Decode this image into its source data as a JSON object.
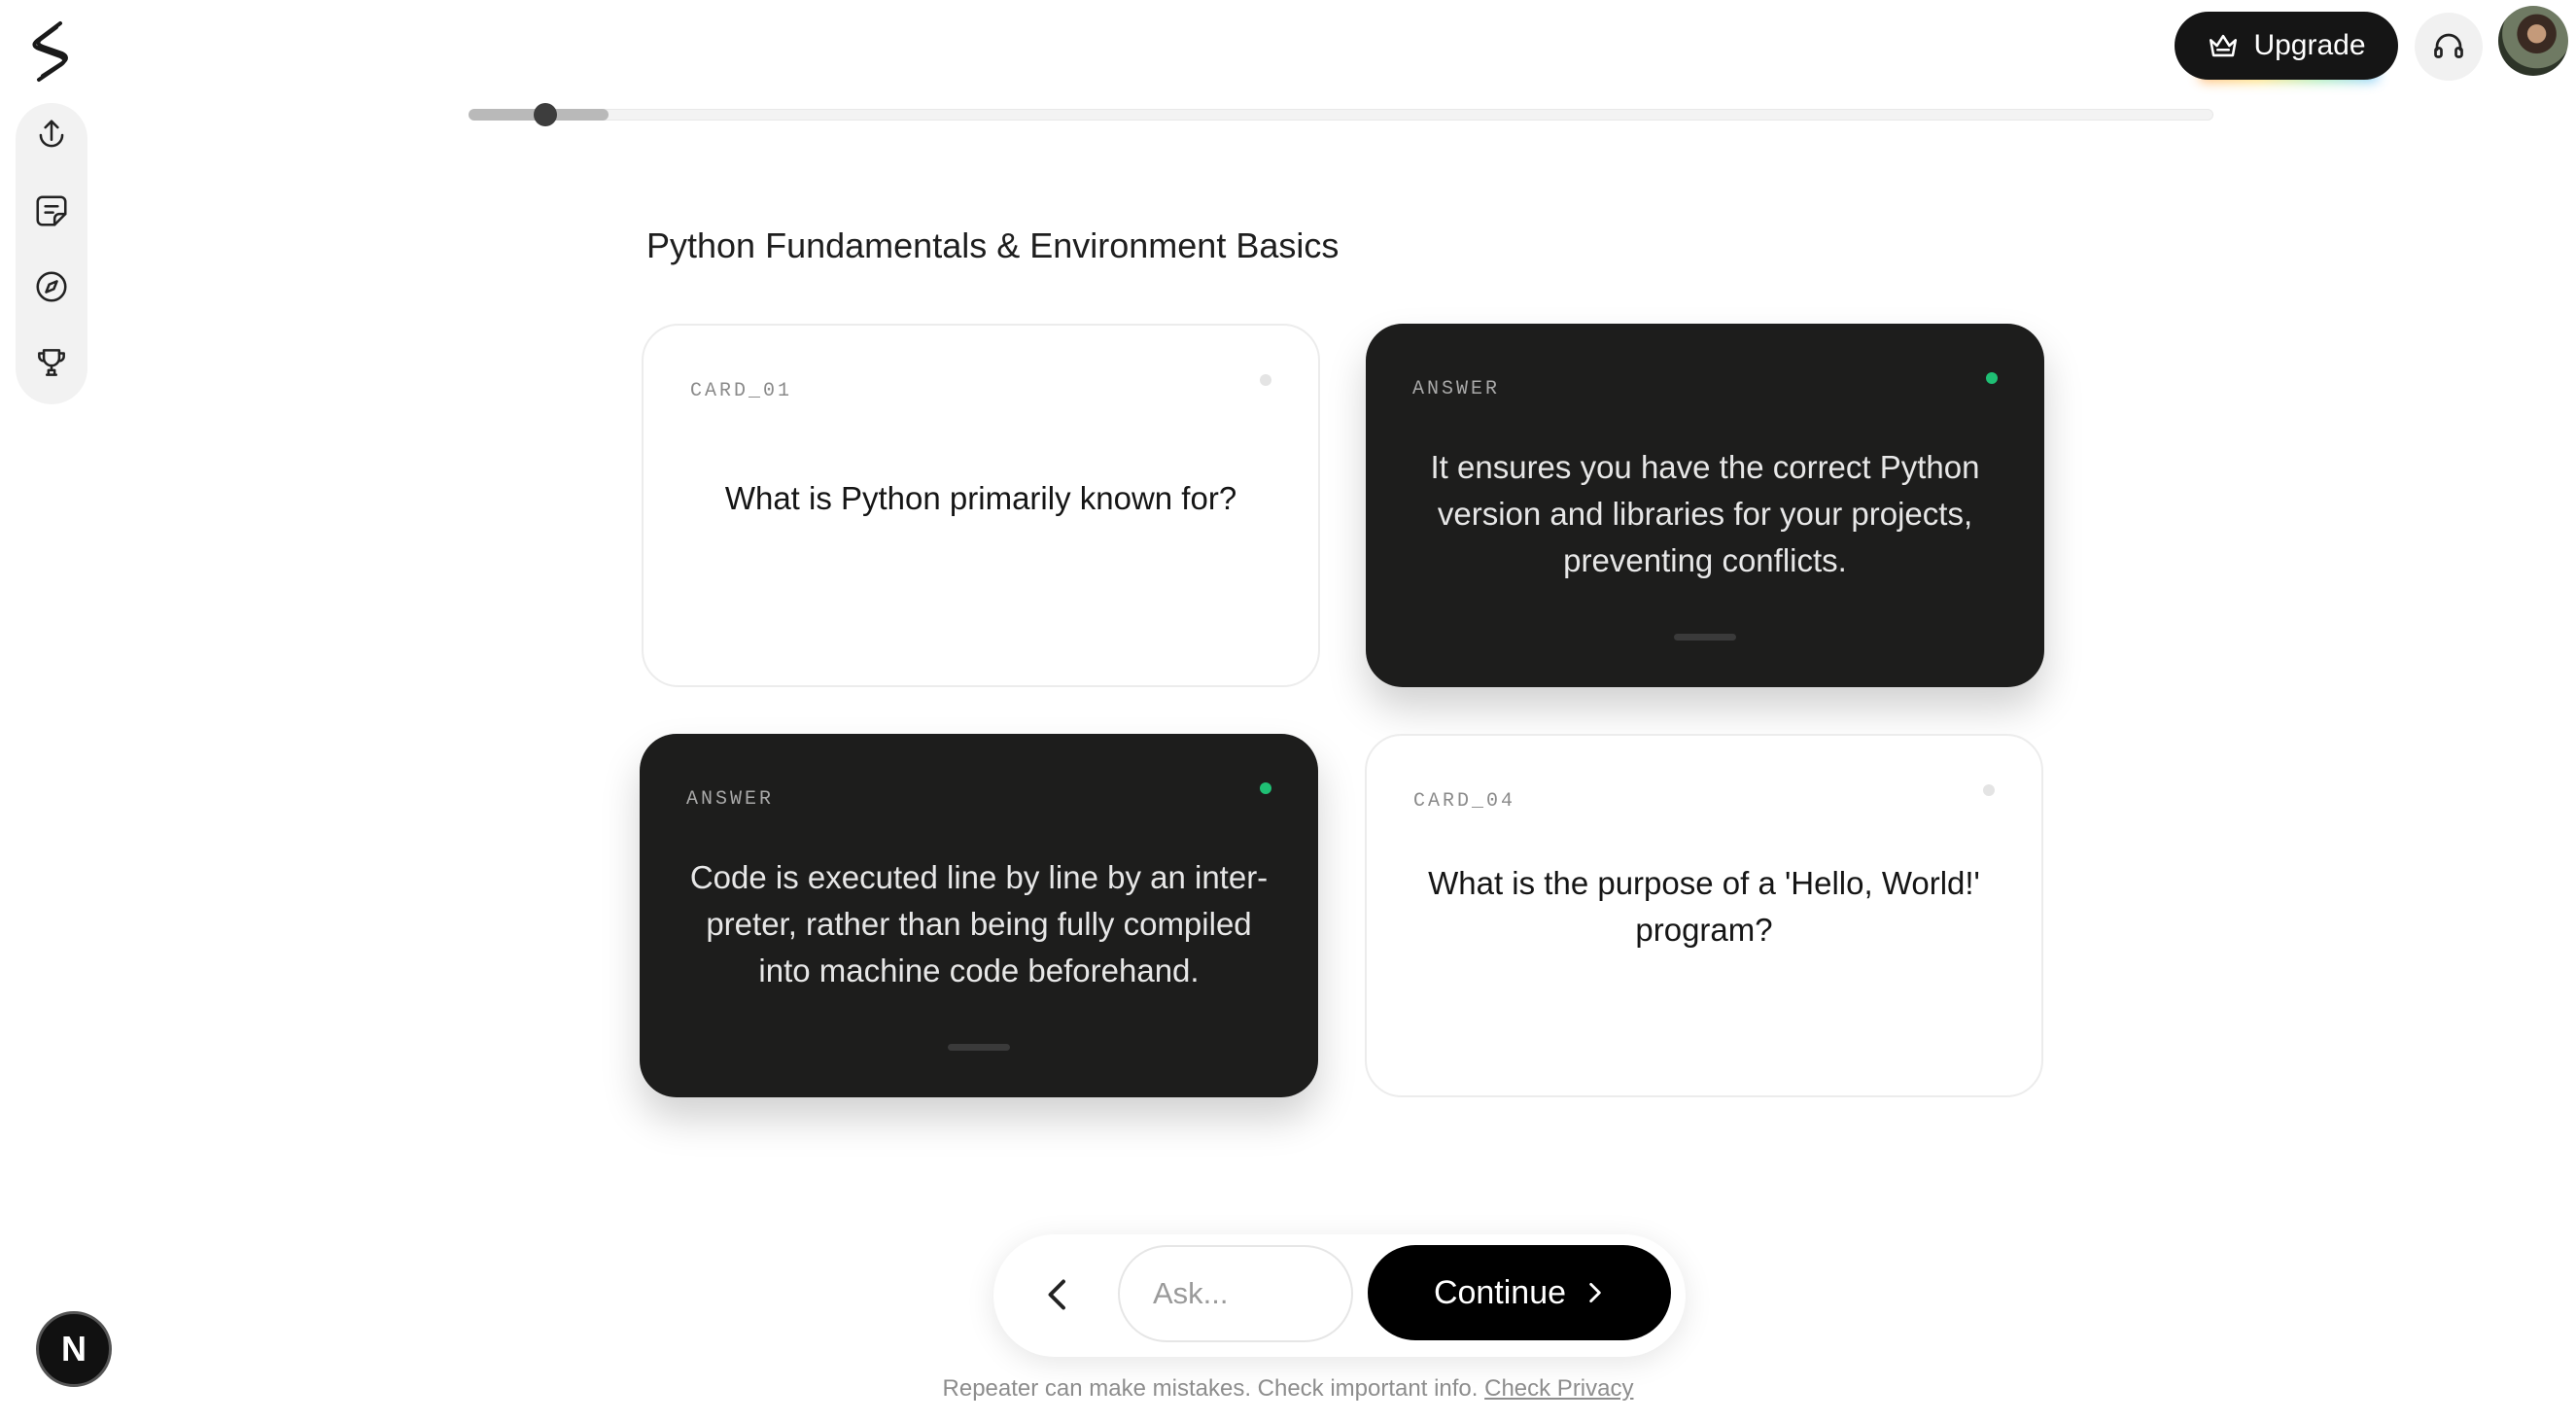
{
  "header": {
    "upgrade_label": "Upgrade",
    "support_icon": "headset-icon",
    "brand_icon": "squiggle-logo"
  },
  "sidebar": {
    "items": [
      {
        "name": "upload",
        "icon": "upload-icon"
      },
      {
        "name": "notes",
        "icon": "sticky-note-icon"
      },
      {
        "name": "explore",
        "icon": "compass-icon"
      },
      {
        "name": "trophy",
        "icon": "trophy-icon"
      }
    ]
  },
  "progress": {
    "fraction": 0.08
  },
  "deck": {
    "title": "Python Fundamentals & Environment Basics",
    "cards": [
      {
        "tag": "CARD_01",
        "side": "question",
        "text": "What is Python primarily known for?"
      },
      {
        "tag": "ANSWER",
        "side": "answer",
        "text": "It ensures you have the correct Python version and libraries for your projects, preventing conflicts."
      },
      {
        "tag": "ANSWER",
        "side": "answer",
        "text": "Code is executed line by line by an inter-preter, rather than being fully compiled into machine code beforehand."
      },
      {
        "tag": "CARD_04",
        "side": "question",
        "text": "What is the purpose of a 'Hello, World!' program?"
      }
    ]
  },
  "composer": {
    "ask_placeholder": "Ask...",
    "continue_label": "Continue"
  },
  "footer": {
    "disclaimer": "Repeater can make mistakes. Check important info.",
    "privacy_link": "Check Privacy"
  },
  "badge": {
    "letter": "N"
  },
  "colors": {
    "accent_dot": "#1fbf74",
    "dark_card": "#1d1d1c"
  }
}
